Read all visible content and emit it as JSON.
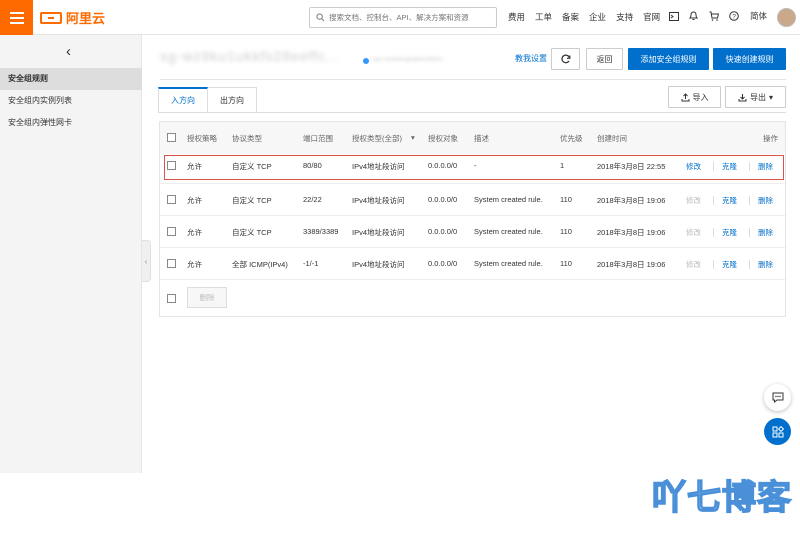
{
  "header": {
    "logo_text": "阿里云",
    "search_placeholder": "搜索文档、控制台、API、解决方案和资源",
    "nav": [
      "费用",
      "工单",
      "备案",
      "企业",
      "支持",
      "官网"
    ],
    "lang": "简体"
  },
  "sidebar": {
    "items": [
      {
        "label": "安全组规则"
      },
      {
        "label": "安全组内实例列表"
      },
      {
        "label": "安全组内弹性网卡"
      }
    ]
  },
  "page": {
    "group_id": "sg-wz9ku1ukkfs28eeffc...",
    "group_sub": "/ vpc-wz9e8oqhqtlkexf8tm0",
    "teach_link": "教我设置",
    "back_button": "返回",
    "add_rule_button": "添加安全组规则",
    "quick_rule_button": "快速创建规则",
    "import_button": "导入",
    "export_button": "导出"
  },
  "tabs": [
    {
      "label": "入方向"
    },
    {
      "label": "出方向"
    }
  ],
  "table": {
    "headers": [
      "授权策略",
      "协议类型",
      "端口范围",
      "授权类型(全部)",
      "授权对象",
      "描述",
      "优先级",
      "创建时间",
      "操作"
    ],
    "rows": [
      {
        "policy": "允许",
        "protocol": "自定义 TCP",
        "port": "80/80",
        "auth_type": "IPv4地址段访问",
        "object": "0.0.0.0/0",
        "desc": "-",
        "priority": "1",
        "created": "2018年3月8日 22:55",
        "modify": "修改",
        "clone": "克隆",
        "delete": "删除"
      },
      {
        "policy": "允许",
        "protocol": "自定义 TCP",
        "port": "22/22",
        "auth_type": "IPv4地址段访问",
        "object": "0.0.0.0/0",
        "desc": "System created rule.",
        "priority": "110",
        "created": "2018年3月8日 19:06",
        "modify": "修改",
        "clone": "克隆",
        "delete": "删除"
      },
      {
        "policy": "允许",
        "protocol": "自定义 TCP",
        "port": "3389/3389",
        "auth_type": "IPv4地址段访问",
        "object": "0.0.0.0/0",
        "desc": "System created rule.",
        "priority": "110",
        "created": "2018年3月8日 19:06",
        "modify": "修改",
        "clone": "克隆",
        "delete": "删除"
      },
      {
        "policy": "允许",
        "protocol": "全部 ICMP(IPv4)",
        "port": "-1/-1",
        "auth_type": "IPv4地址段访问",
        "object": "0.0.0.0/0",
        "desc": "System created rule.",
        "priority": "110",
        "created": "2018年3月8日 19:06",
        "modify": "修改",
        "clone": "克隆",
        "delete": "删除"
      }
    ],
    "bulk_delete": "删除"
  },
  "watermark": "吖七博客",
  "colors": {
    "brand": "#ff6a00",
    "primary": "#0070cc",
    "highlight": "#d9534f"
  }
}
